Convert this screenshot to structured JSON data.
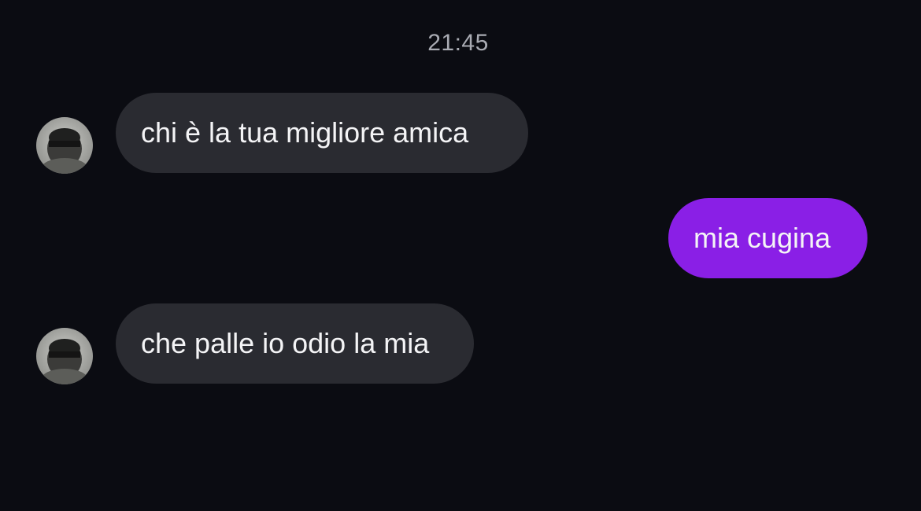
{
  "chat": {
    "timestamp": "21:45",
    "messages": [
      {
        "sender": "other",
        "text": "chi è la tua migliore amica"
      },
      {
        "sender": "me",
        "text": "mia cugina"
      },
      {
        "sender": "other",
        "text": "che palle io odio la mia"
      }
    ]
  },
  "colors": {
    "background": "#0b0c12",
    "incoming_bubble": "#2a2b31",
    "outgoing_bubble": "#8a1fe6",
    "timestamp_text": "#a9abb3",
    "message_text": "#f4f4f6"
  },
  "icons": {
    "avatar": "user-avatar-photo"
  }
}
